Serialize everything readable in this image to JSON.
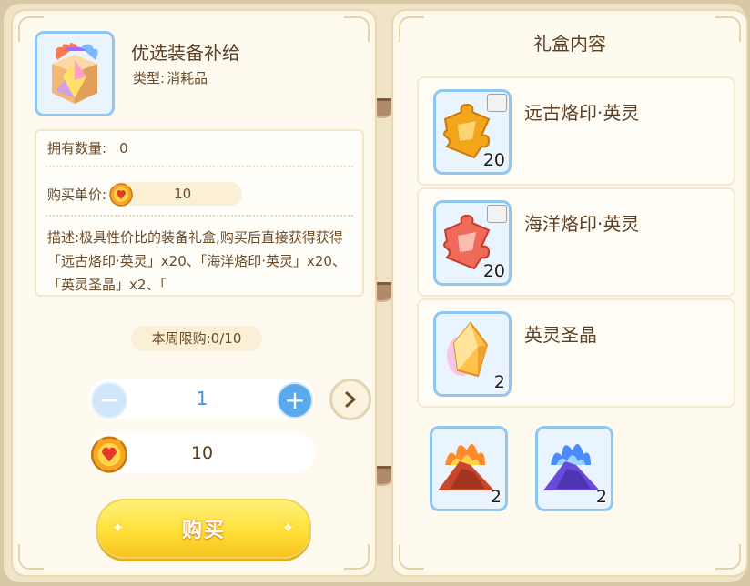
{
  "item": {
    "name": "优选装备补给",
    "type_label": "类型:",
    "type_value": "消耗品",
    "icon": "gift-box-icon"
  },
  "info": {
    "owned_label": "拥有数量:",
    "owned_value": "0",
    "price_label": "购买单价:",
    "price_value": "10",
    "currency_icon": "coin-icon",
    "description": "描述:极具性价比的装备礼盒,购买后直接获得获得「远古烙印·英灵」x20、「海洋烙印·英灵」x20、「英灵圣晶」x2、「"
  },
  "purchase": {
    "weekly_limit": "本周限购:0/10",
    "quantity": "1",
    "total": "10",
    "buy_label": "购买"
  },
  "rewards": {
    "title": "礼盒内容",
    "items": [
      {
        "name": "远古烙印·英灵",
        "count": "20",
        "icon": "gold-puzzle-icon"
      },
      {
        "name": "海洋烙印·英灵",
        "count": "20",
        "icon": "red-puzzle-icon"
      },
      {
        "name": "英灵圣晶",
        "count": "2",
        "icon": "crystal-icon"
      }
    ],
    "extra": [
      {
        "count": "2",
        "icon": "fire-sand-icon"
      },
      {
        "count": "2",
        "icon": "frost-sand-icon"
      }
    ]
  },
  "colors": {
    "accent_blue": "#5aa9ec",
    "buy_yellow": "#ffe03a",
    "text_brown": "#6b4b2a"
  }
}
